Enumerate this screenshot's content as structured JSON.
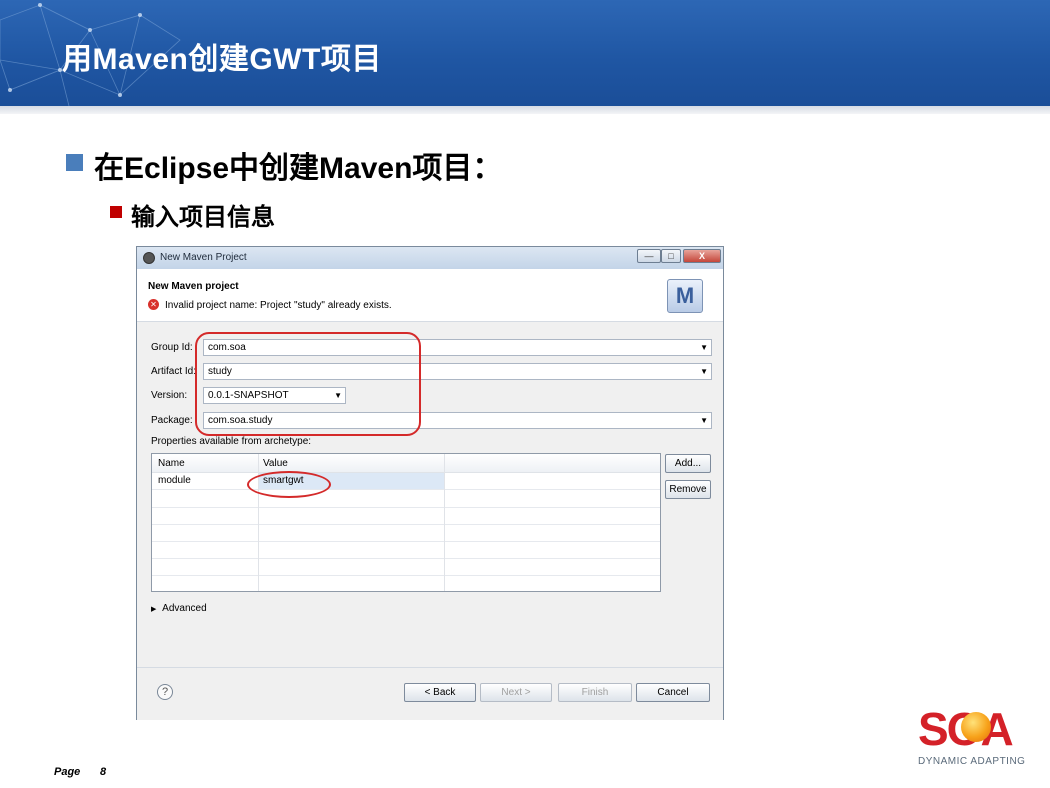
{
  "slide": {
    "title": "用Maven创建GWT项目",
    "bullet1": "在Eclipse中创建Maven项目：",
    "bullet2": "输入项目信息",
    "page_label": "Page",
    "page_number": "8"
  },
  "dialog": {
    "window_title": "New Maven Project",
    "minimize": "—",
    "maximize": "□",
    "close": "X",
    "header_title": "New Maven project",
    "error_message": "Invalid project name: Project \"study\" already exists.",
    "header_icon_label": "M",
    "form": {
      "group_id_label": "Group Id:",
      "group_id_value": "com.soa",
      "artifact_id_label": "Artifact Id:",
      "artifact_id_value": "study",
      "version_label": "Version:",
      "version_value": "0.0.1-SNAPSHOT",
      "package_label": "Package:",
      "package_value": "com.soa.study"
    },
    "properties_label": "Properties available from archetype:",
    "table": {
      "columns": [
        "Name",
        "Value"
      ],
      "rows": [
        {
          "name": "module",
          "value": "smartgwt"
        }
      ]
    },
    "add_button": "Add...",
    "remove_button": "Remove",
    "advanced": "Advanced",
    "help_icon_label": "?",
    "back_button": "< Back",
    "next_button": "Next >",
    "finish_button": "Finish",
    "cancel_button": "Cancel"
  },
  "logo": {
    "wordmark": "SOA",
    "tagline": "DYNAMIC ADAPTING"
  },
  "colors": {
    "banner": "#1f56a3",
    "bullet1": "#4a7ebb",
    "bullet2": "#c00000",
    "annotation": "#d42a2a",
    "logo_red": "#d42128"
  }
}
